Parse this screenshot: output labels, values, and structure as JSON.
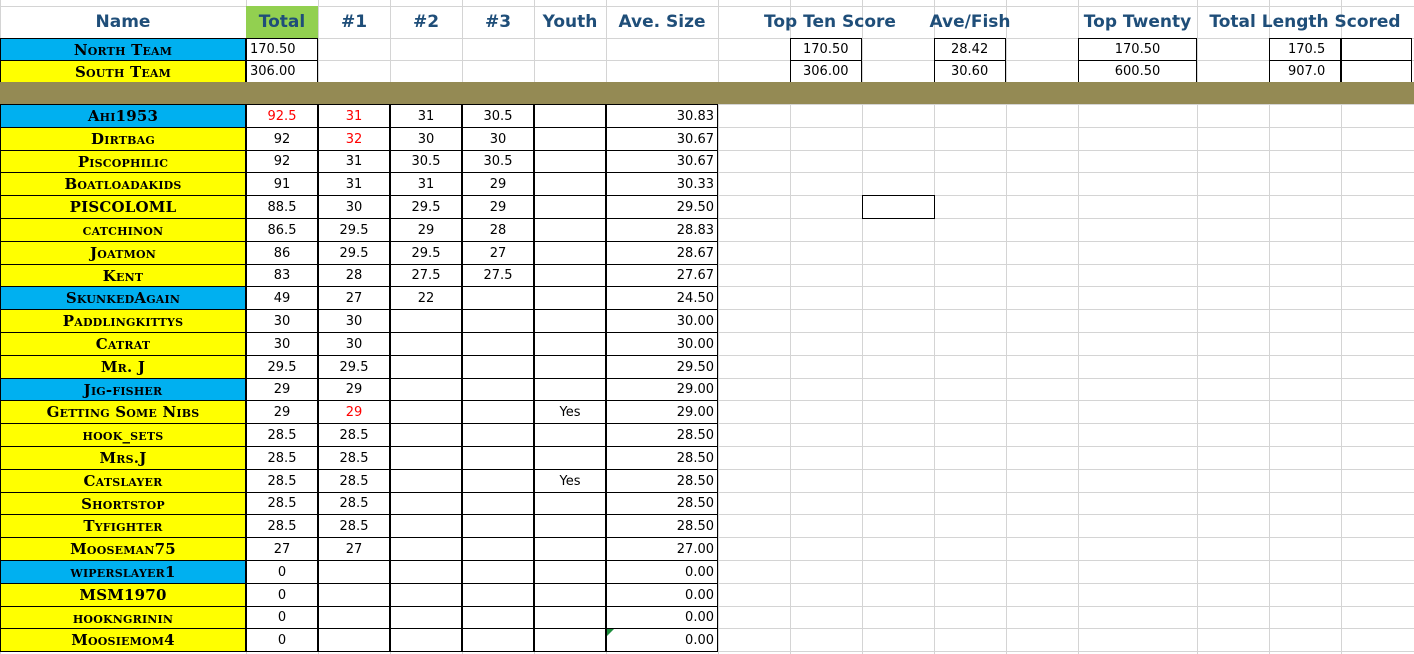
{
  "headers": {
    "name": "Name",
    "total": "Total",
    "n1": "#1",
    "n2": "#2",
    "n3": "#3",
    "youth": "Youth",
    "ave": "Ave. Size",
    "top_ten": "Top Ten Score",
    "ave_fish": "Ave/Fish",
    "top_twenty": "Top Twenty",
    "total_length": "Total Length Scored"
  },
  "teams": [
    {
      "name": "North Team",
      "total": "170.50",
      "top_ten": "170.50",
      "ave_fish": "28.42",
      "top_twenty": "170.50",
      "total_length": "170.5"
    },
    {
      "name": "South Team",
      "total": "306.00",
      "top_ten": "306.00",
      "ave_fish": "30.60",
      "top_twenty": "600.50",
      "total_length": "907.0"
    }
  ],
  "players": [
    {
      "name": "Ahi1953",
      "total": "92.5",
      "n1": "31",
      "n2": "31",
      "n3": "30.5",
      "youth": "",
      "ave": "30.83"
    },
    {
      "name": "Dirtbag",
      "total": "92",
      "n1": "32",
      "n2": "30",
      "n3": "30",
      "youth": "",
      "ave": "30.67"
    },
    {
      "name": "Piscophilic",
      "total": "92",
      "n1": "31",
      "n2": "30.5",
      "n3": "30.5",
      "youth": "",
      "ave": "30.67"
    },
    {
      "name": "Boatloadakids",
      "total": "91",
      "n1": "31",
      "n2": "31",
      "n3": "29",
      "youth": "",
      "ave": "30.33"
    },
    {
      "name": "PISCOLOML",
      "total": "88.5",
      "n1": "30",
      "n2": "29.5",
      "n3": "29",
      "youth": "",
      "ave": "29.50"
    },
    {
      "name": "catchinon",
      "total": "86.5",
      "n1": "29.5",
      "n2": "29",
      "n3": "28",
      "youth": "",
      "ave": "28.83"
    },
    {
      "name": "Joatmon",
      "total": "86",
      "n1": "29.5",
      "n2": "29.5",
      "n3": "27",
      "youth": "",
      "ave": "28.67"
    },
    {
      "name": "Kent",
      "total": "83",
      "n1": "28",
      "n2": "27.5",
      "n3": "27.5",
      "youth": "",
      "ave": "27.67"
    },
    {
      "name": "SkunkedAgain",
      "total": "49",
      "n1": "27",
      "n2": "22",
      "n3": "",
      "youth": "",
      "ave": "24.50"
    },
    {
      "name": "Paddlingkittys",
      "total": "30",
      "n1": "30",
      "n2": "",
      "n3": "",
      "youth": "",
      "ave": "30.00"
    },
    {
      "name": "Catrat",
      "total": "30",
      "n1": "30",
      "n2": "",
      "n3": "",
      "youth": "",
      "ave": "30.00"
    },
    {
      "name": "Mr. J",
      "total": "29.5",
      "n1": "29.5",
      "n2": "",
      "n3": "",
      "youth": "",
      "ave": "29.50"
    },
    {
      "name": "Jig-fisher",
      "total": "29",
      "n1": "29",
      "n2": "",
      "n3": "",
      "youth": "",
      "ave": "29.00"
    },
    {
      "name": "Getting Some Nibs",
      "total": "29",
      "n1": "29",
      "n2": "",
      "n3": "",
      "youth": "Yes",
      "ave": "29.00"
    },
    {
      "name": "hook_sets",
      "total": "28.5",
      "n1": "28.5",
      "n2": "",
      "n3": "",
      "youth": "",
      "ave": "28.50"
    },
    {
      "name": "Mrs.J",
      "total": "28.5",
      "n1": "28.5",
      "n2": "",
      "n3": "",
      "youth": "",
      "ave": "28.50"
    },
    {
      "name": "Catslayer",
      "total": "28.5",
      "n1": "28.5",
      "n2": "",
      "n3": "",
      "youth": "Yes",
      "ave": "28.50"
    },
    {
      "name": "Shortstop",
      "total": "28.5",
      "n1": "28.5",
      "n2": "",
      "n3": "",
      "youth": "",
      "ave": "28.50"
    },
    {
      "name": "Tyfighter",
      "total": "28.5",
      "n1": "28.5",
      "n2": "",
      "n3": "",
      "youth": "",
      "ave": "28.50"
    },
    {
      "name": "Mooseman75",
      "total": "27",
      "n1": "27",
      "n2": "",
      "n3": "",
      "youth": "",
      "ave": "27.00"
    },
    {
      "name": "wiperslayer1",
      "total": "0",
      "n1": "",
      "n2": "",
      "n3": "",
      "youth": "",
      "ave": "0.00"
    },
    {
      "name": "MSM1970",
      "total": "0",
      "n1": "",
      "n2": "",
      "n3": "",
      "youth": "",
      "ave": "0.00"
    },
    {
      "name": "hookngrinin",
      "total": "0",
      "n1": "",
      "n2": "",
      "n3": "",
      "youth": "",
      "ave": "0.00"
    },
    {
      "name": "Moosiemom4",
      "total": "0",
      "n1": "",
      "n2": "",
      "n3": "",
      "youth": "",
      "ave": "0.00"
    }
  ],
  "team_colors": {
    "north": "#00b0f0",
    "south": "#ffff00"
  },
  "player_team": [
    "north",
    "south",
    "south",
    "south",
    "south",
    "south",
    "south",
    "south",
    "north",
    "south",
    "south",
    "south",
    "north",
    "south",
    "south",
    "south",
    "south",
    "south",
    "south",
    "south",
    "north",
    "south",
    "south",
    "south"
  ],
  "red_cells": [
    "players.0.total",
    "players.0.n1",
    "players.1.n1",
    "players.13.n1"
  ],
  "colors": {
    "header_text": "#1f4e79",
    "total_header_bg": "#92d050",
    "separator": "#948a54",
    "highlight_text": "#ff0000"
  }
}
